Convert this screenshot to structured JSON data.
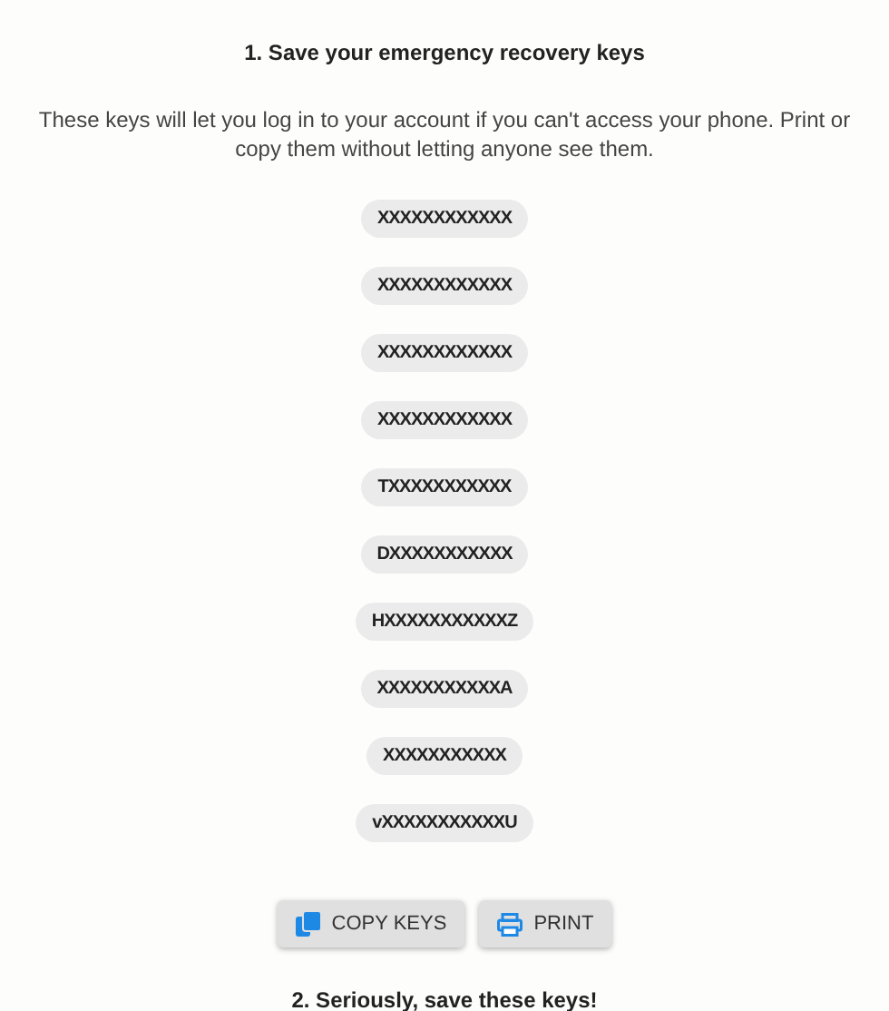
{
  "heading": "1. Save your emergency recovery keys",
  "description": "These keys will let you log in to your account if you can't access your phone. Print or copy them without letting anyone see them.",
  "keys": [
    "XXXXXXXXXXXX",
    "XXXXXXXXXXXX",
    "XXXXXXXXXXXX",
    "XXXXXXXXXXXX",
    "TXXXXXXXXXXX",
    "DXXXXXXXXXXX",
    "HXXXXXXXXXXXZ",
    "XXXXXXXXXXXA",
    "XXXXXXXXXXX",
    "vXXXXXXXXXXXU"
  ],
  "buttons": [
    {
      "kind": "copy",
      "label": "COPY KEYS"
    },
    {
      "kind": "print",
      "label": "PRINT"
    }
  ],
  "next_heading": "2. Seriously, save these keys!"
}
